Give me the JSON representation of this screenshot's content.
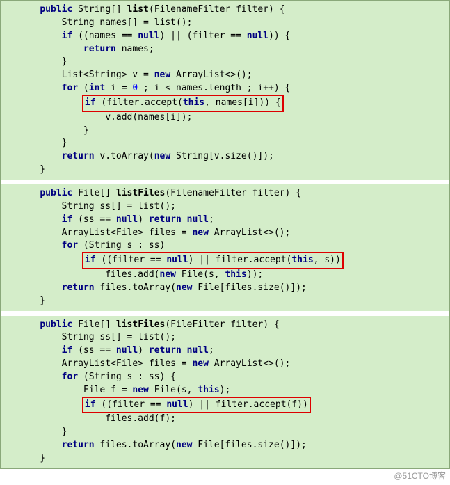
{
  "watermark": "@51CTO博客",
  "block1": {
    "l1a": "    ",
    "l1b": "public",
    "l1c": " String[] ",
    "l1d": "list",
    "l1e": "(FilenameFilter filter) {",
    "l2": "        String names[] = list();",
    "l3a": "        ",
    "l3b": "if",
    "l3c": " ((names == ",
    "l3d": "null",
    "l3e": ") || (filter == ",
    "l3f": "null",
    "l3g": ")) {",
    "l4a": "            ",
    "l4b": "return",
    "l4c": " names;",
    "l5": "        }",
    "l6a": "        List<String> v = ",
    "l6b": "new",
    "l6c": " ArrayList<>();",
    "l7a": "        ",
    "l7b": "for",
    "l7c": " (",
    "l7d": "int",
    "l7e": " i = ",
    "l7f": "0",
    "l7g": " ; i < names.length ; i++) {",
    "l8a": "            ",
    "l8b": "if",
    "l8c": " (filter.accept(",
    "l8d": "this",
    "l8e": ", names[i])) {",
    "l9": "                v.add(names[i]);",
    "l10": "            }",
    "l11": "        }",
    "l12a": "        ",
    "l12b": "return",
    "l12c": " v.toArray(",
    "l12d": "new",
    "l12e": " String[v.size()]);",
    "l13": "    }"
  },
  "block2": {
    "l1a": "    ",
    "l1b": "public",
    "l1c": " File[] ",
    "l1d": "listFiles",
    "l1e": "(FilenameFilter filter) {",
    "l2": "        String ss[] = list();",
    "l3a": "        ",
    "l3b": "if",
    "l3c": " (ss == ",
    "l3d": "null",
    "l3e": ") ",
    "l3f": "return null",
    "l3g": ";",
    "l4a": "        ArrayList<File> files = ",
    "l4b": "new",
    "l4c": " ArrayList<>();",
    "l5a": "        ",
    "l5b": "for",
    "l5c": " (String s : ss)",
    "l6a": "            ",
    "l6b": "if",
    "l6c": " ((filter == ",
    "l6d": "null",
    "l6e": ") || filter.accept(",
    "l6f": "this",
    "l6g": ", s))",
    "l7a": "                files.add(",
    "l7b": "new",
    "l7c": " File(s, ",
    "l7d": "this",
    "l7e": "));",
    "l8a": "        ",
    "l8b": "return",
    "l8c": " files.toArray(",
    "l8d": "new",
    "l8e": " File[files.size()]);",
    "l9": "    }"
  },
  "block3": {
    "l1a": "    ",
    "l1b": "public",
    "l1c": " File[] ",
    "l1d": "listFiles",
    "l1e": "(FileFilter filter) {",
    "l2": "        String ss[] = list();",
    "l3a": "        ",
    "l3b": "if",
    "l3c": " (ss == ",
    "l3d": "null",
    "l3e": ") ",
    "l3f": "return null",
    "l3g": ";",
    "l4a": "        ArrayList<File> files = ",
    "l4b": "new",
    "l4c": " ArrayList<>();",
    "l5a": "        ",
    "l5b": "for",
    "l5c": " (String s : ss) {",
    "l6a": "            File f = ",
    "l6b": "new",
    "l6c": " File(s, ",
    "l6d": "this",
    "l6e": ");",
    "l7a": "            ",
    "l7b": "if",
    "l7c": " ((filter == ",
    "l7d": "null",
    "l7e": ") || filter.accept(f))",
    "l8": "                files.add(f);",
    "l9": "        }",
    "l10a": "        ",
    "l10b": "return",
    "l10c": " files.toArray(",
    "l10d": "new",
    "l10e": " File[files.size()]);",
    "l11": "    }"
  }
}
